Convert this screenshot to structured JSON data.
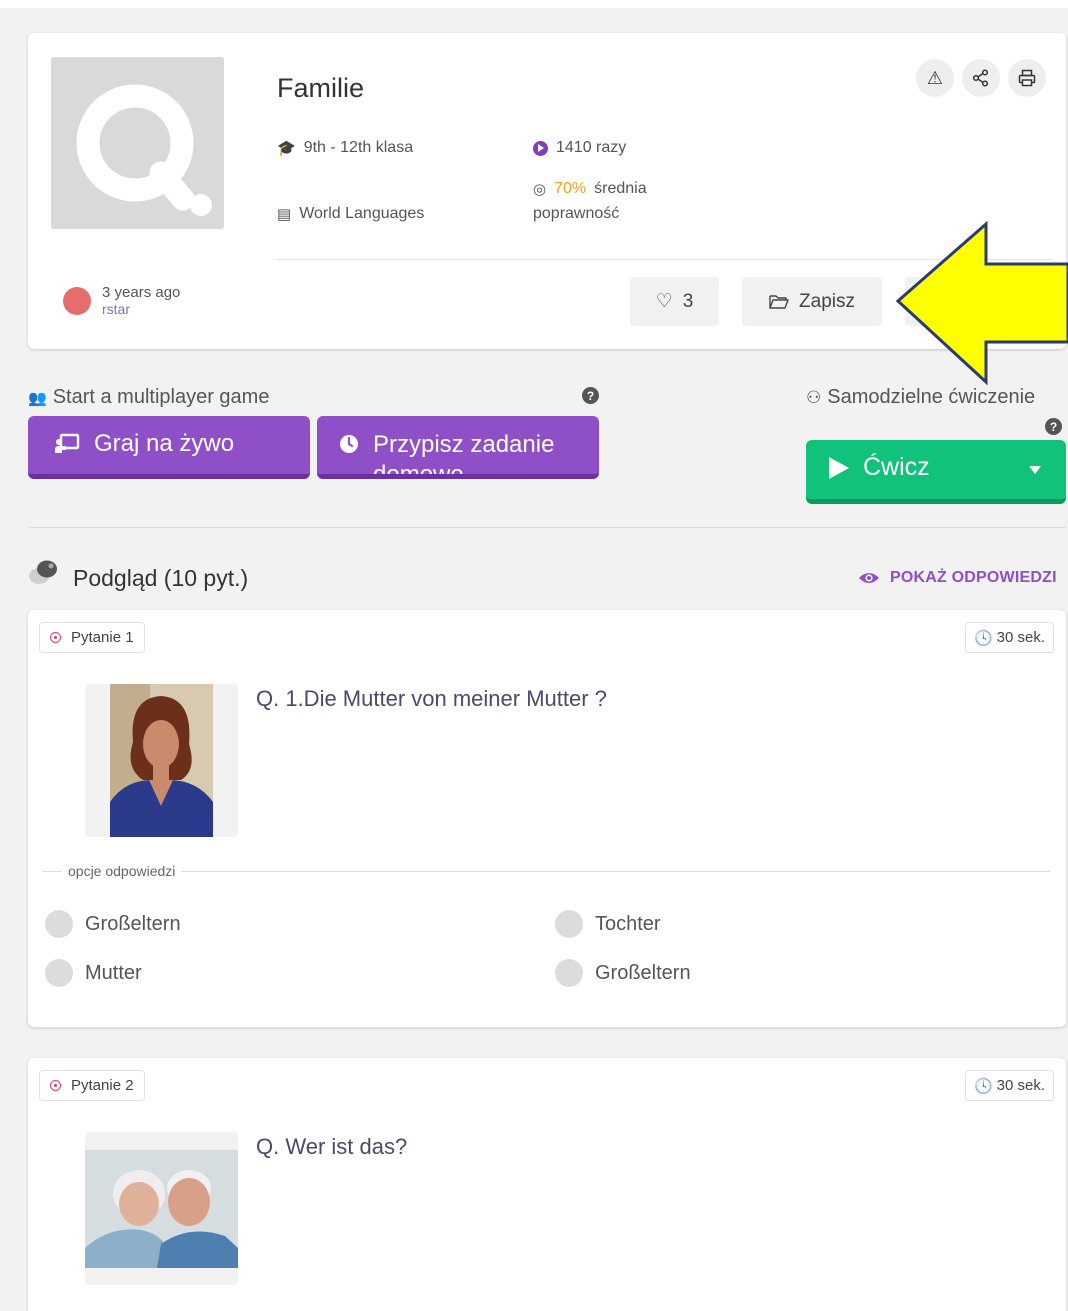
{
  "quiz": {
    "title": "Familie",
    "grade": "9th - 12th klasa",
    "subject": "World Languages",
    "plays": "1410 razy",
    "accuracy_value": "70%",
    "accuracy_label": "średnia",
    "accuracy_label2": "poprawność",
    "posted": "3 years ago",
    "author": "rstar",
    "likes": "3",
    "save_label": "Zapisz"
  },
  "multiplayer": {
    "heading": "Start a multiplayer game",
    "live_label": "Graj na żywo",
    "assign_label_line1": "Przypisz zadanie",
    "assign_label_line2": "domowe"
  },
  "solo": {
    "heading": "Samodzielne ćwiczenie",
    "practice_label": "Ćwicz"
  },
  "preview": {
    "title": "Podgląd (10 pyt.)",
    "show_answers": "POKAŻ ODPOWIEDZI"
  },
  "questions": [
    {
      "tag": "Pytanie 1",
      "time": "30 sek.",
      "text": "Q. 1.Die Mutter von meiner Mutter ?",
      "options_label": "opcje odpowiedzi",
      "options": [
        "Großeltern",
        "Tochter",
        "Mutter",
        "Großeltern"
      ]
    },
    {
      "tag": "Pytanie 2",
      "time": "30 sek.",
      "text": "Q. Wer ist das?"
    }
  ],
  "colors": {
    "accent_purple": "#8e4fc7",
    "accent_green": "#10c27a",
    "annotation_arrow": "#ffff00"
  }
}
